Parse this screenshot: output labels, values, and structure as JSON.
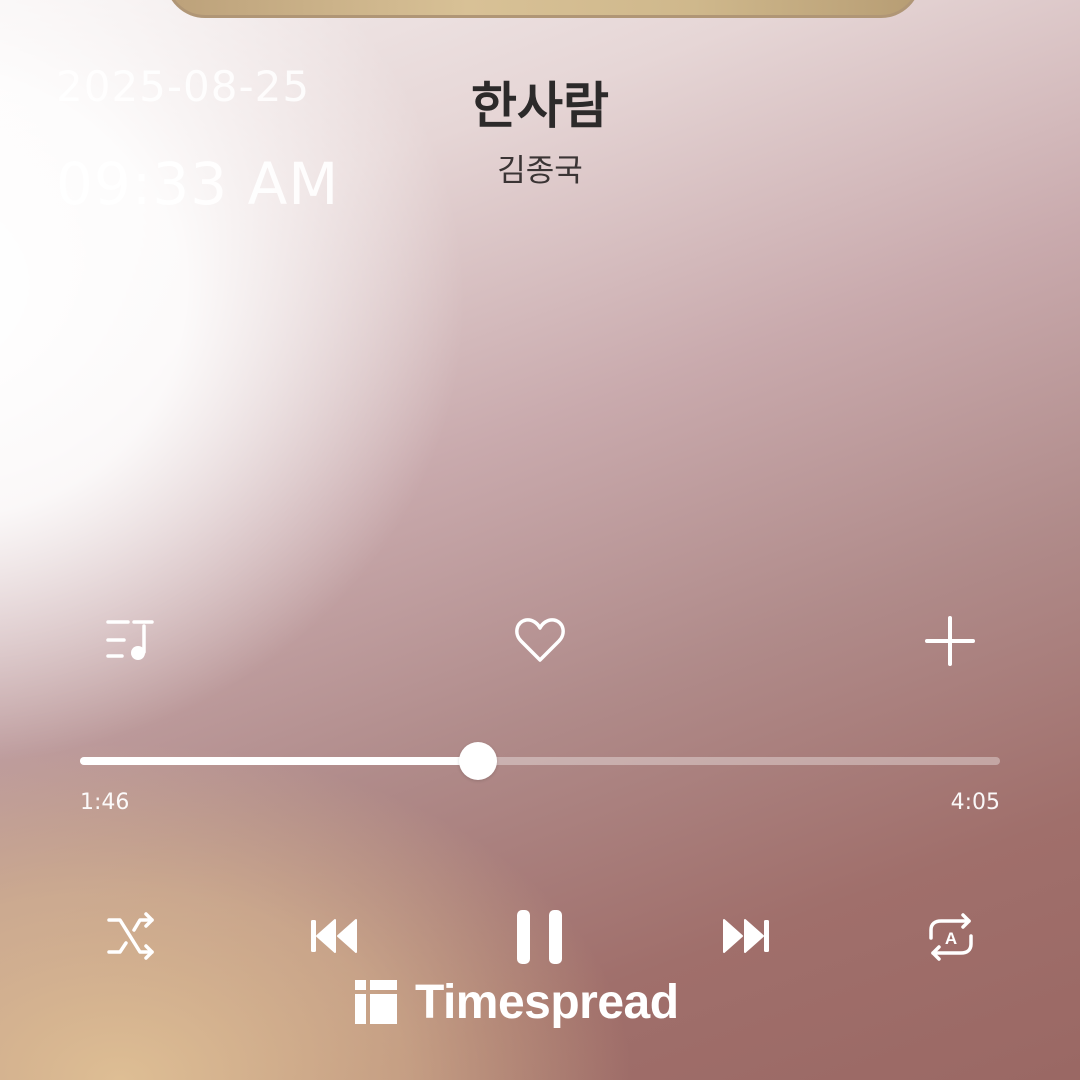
{
  "clock": {
    "date": "2025-08-25",
    "time": "09:33 AM"
  },
  "track": {
    "title": "한사람",
    "artist": "김종국"
  },
  "actions": {
    "playlist_icon": "playlist-icon",
    "like_icon": "heart-icon",
    "add_icon": "plus-icon"
  },
  "progress": {
    "elapsed": "1:46",
    "total": "4:05",
    "fraction": 0.433
  },
  "controls": {
    "shuffle_icon": "shuffle-icon",
    "previous_icon": "previous-icon",
    "playpause_icon": "pause-icon",
    "next_icon": "next-icon",
    "repeat_icon": "repeat-icon"
  },
  "brand": {
    "name": "Timespread"
  },
  "colors": {
    "accent": "#ffffff",
    "text_dark": "#2c2a2a"
  }
}
